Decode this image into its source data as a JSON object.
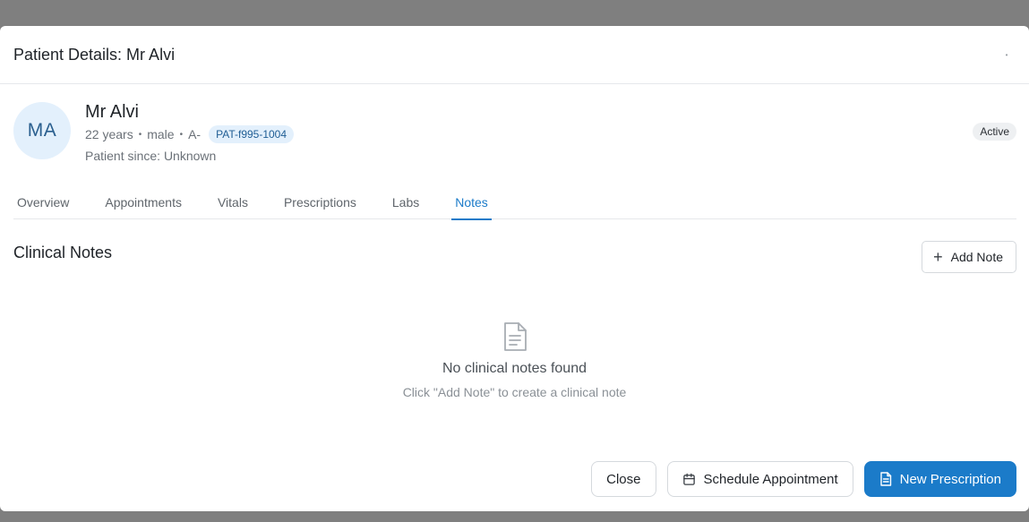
{
  "modal": {
    "title": "Patient Details: Mr Alvi",
    "close_icon": "dot-icon"
  },
  "patient": {
    "initials": "MA",
    "name": "Mr Alvi",
    "age": "22 years",
    "gender": "male",
    "blood_type": "A-",
    "patient_id": "PAT-f995-1004",
    "since": "Patient since: Unknown",
    "status": "Active"
  },
  "tabs": [
    {
      "label": "Overview",
      "active": false
    },
    {
      "label": "Appointments",
      "active": false
    },
    {
      "label": "Vitals",
      "active": false
    },
    {
      "label": "Prescriptions",
      "active": false
    },
    {
      "label": "Labs",
      "active": false
    },
    {
      "label": "Notes",
      "active": true
    }
  ],
  "notes": {
    "title": "Clinical Notes",
    "add_label": "Add Note",
    "empty_title": "No clinical notes found",
    "empty_sub": "Click \"Add Note\" to create a clinical note"
  },
  "footer": {
    "close_label": "Close",
    "schedule_label": "Schedule Appointment",
    "prescription_label": "New Prescription"
  },
  "colors": {
    "accent": "#1b7bc9",
    "avatar_bg": "#e3f0fc",
    "overlay": "#7f7f7f"
  }
}
